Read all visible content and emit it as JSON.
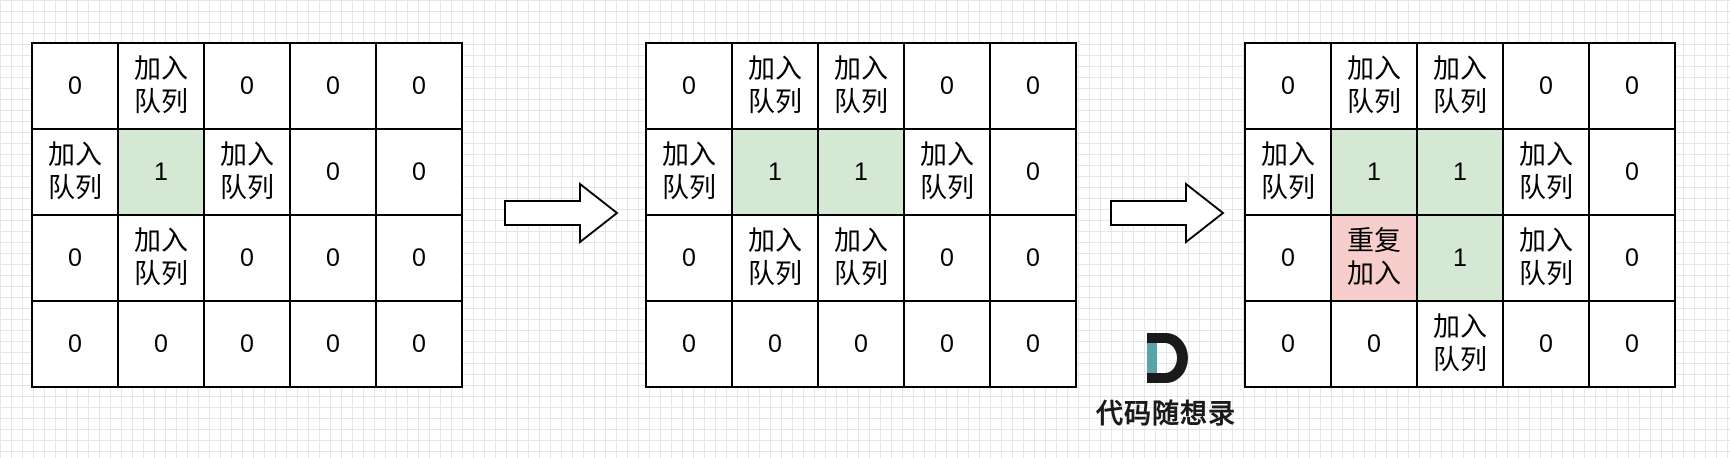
{
  "grids": [
    {
      "cells": [
        [
          {
            "t": "0",
            "s": ""
          },
          {
            "t": "加入\n队列",
            "s": ""
          },
          {
            "t": "0",
            "s": ""
          },
          {
            "t": "0",
            "s": ""
          },
          {
            "t": "0",
            "s": ""
          }
        ],
        [
          {
            "t": "加入\n队列",
            "s": ""
          },
          {
            "t": "1",
            "s": "visited"
          },
          {
            "t": "加入\n队列",
            "s": ""
          },
          {
            "t": "0",
            "s": ""
          },
          {
            "t": "0",
            "s": ""
          }
        ],
        [
          {
            "t": "0",
            "s": ""
          },
          {
            "t": "加入\n队列",
            "s": ""
          },
          {
            "t": "0",
            "s": ""
          },
          {
            "t": "0",
            "s": ""
          },
          {
            "t": "0",
            "s": ""
          }
        ],
        [
          {
            "t": "0",
            "s": ""
          },
          {
            "t": "0",
            "s": ""
          },
          {
            "t": "0",
            "s": ""
          },
          {
            "t": "0",
            "s": ""
          },
          {
            "t": "0",
            "s": ""
          }
        ]
      ]
    },
    {
      "cells": [
        [
          {
            "t": "0",
            "s": ""
          },
          {
            "t": "加入\n队列",
            "s": ""
          },
          {
            "t": "加入\n队列",
            "s": ""
          },
          {
            "t": "0",
            "s": ""
          },
          {
            "t": "0",
            "s": ""
          }
        ],
        [
          {
            "t": "加入\n队列",
            "s": ""
          },
          {
            "t": "1",
            "s": "visited"
          },
          {
            "t": "1",
            "s": "visited"
          },
          {
            "t": "加入\n队列",
            "s": ""
          },
          {
            "t": "0",
            "s": ""
          }
        ],
        [
          {
            "t": "0",
            "s": ""
          },
          {
            "t": "加入\n队列",
            "s": ""
          },
          {
            "t": "加入\n队列",
            "s": ""
          },
          {
            "t": "0",
            "s": ""
          },
          {
            "t": "0",
            "s": ""
          }
        ],
        [
          {
            "t": "0",
            "s": ""
          },
          {
            "t": "0",
            "s": ""
          },
          {
            "t": "0",
            "s": ""
          },
          {
            "t": "0",
            "s": ""
          },
          {
            "t": "0",
            "s": ""
          }
        ]
      ]
    },
    {
      "cells": [
        [
          {
            "t": "0",
            "s": ""
          },
          {
            "t": "加入\n队列",
            "s": ""
          },
          {
            "t": "加入\n队列",
            "s": ""
          },
          {
            "t": "0",
            "s": ""
          },
          {
            "t": "0",
            "s": ""
          }
        ],
        [
          {
            "t": "加入\n队列",
            "s": ""
          },
          {
            "t": "1",
            "s": "visited"
          },
          {
            "t": "1",
            "s": "visited"
          },
          {
            "t": "加入\n队列",
            "s": ""
          },
          {
            "t": "0",
            "s": ""
          }
        ],
        [
          {
            "t": "0",
            "s": ""
          },
          {
            "t": "重复\n加入",
            "s": "dup"
          },
          {
            "t": "1",
            "s": "visited"
          },
          {
            "t": "加入\n队列",
            "s": ""
          },
          {
            "t": "0",
            "s": ""
          }
        ],
        [
          {
            "t": "0",
            "s": ""
          },
          {
            "t": "0",
            "s": ""
          },
          {
            "t": "加入\n队列",
            "s": ""
          },
          {
            "t": "0",
            "s": ""
          },
          {
            "t": "0",
            "s": ""
          }
        ]
      ]
    }
  ],
  "colors": {
    "visited": "#d5e8d4",
    "duplicate": "#f8cecc",
    "border": "#000000",
    "logo_teal": "#5aa3a8",
    "logo_dark": "#1a1a1a"
  },
  "watermark": {
    "logo_icon": "d-letter-logo-icon",
    "text": "代码随想录"
  }
}
